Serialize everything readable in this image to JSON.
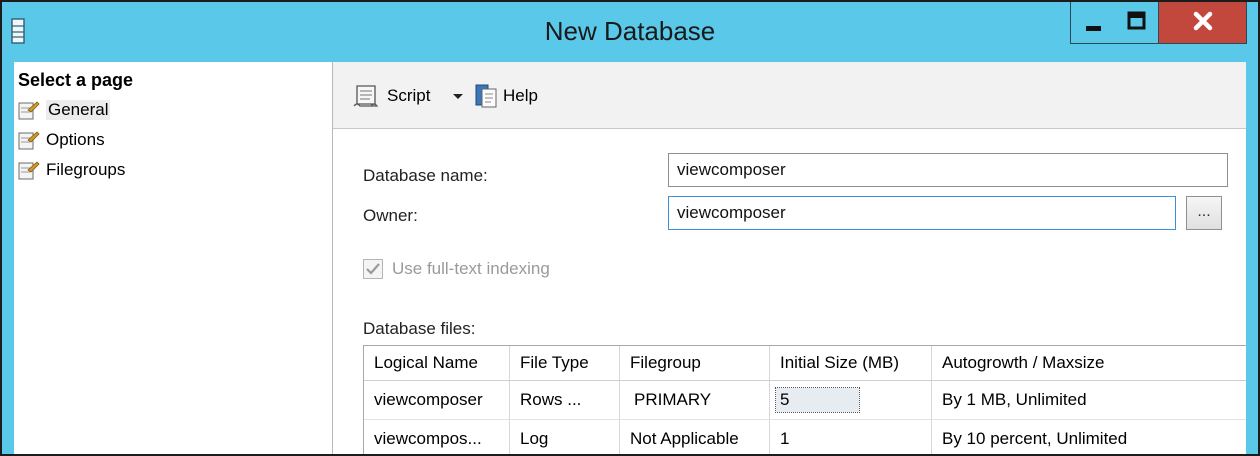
{
  "window": {
    "title": "New Database",
    "icon": "database-icon",
    "controls": {
      "minimize": "minimize-icon",
      "maximize": "maximize-icon",
      "close": "close-icon"
    },
    "colors": {
      "titlebar": "#5ac8e8",
      "close": "#c2473d"
    }
  },
  "sidebar": {
    "header": "Select a page",
    "items": [
      {
        "label": "General",
        "icon": "page-wrench-icon",
        "selected": true
      },
      {
        "label": "Options",
        "icon": "page-wrench-icon",
        "selected": false
      },
      {
        "label": "Filegroups",
        "icon": "page-wrench-icon",
        "selected": false
      }
    ]
  },
  "toolbar": {
    "script_label": "Script",
    "script_icon": "script-scroll-icon",
    "dropdown_icon": "dropdown-arrow-icon",
    "help_label": "Help",
    "help_icon": "help-book-icon"
  },
  "form": {
    "database_name_label": "Database name:",
    "database_name_value": "viewcomposer",
    "owner_label": "Owner:",
    "owner_value": "viewcomposer",
    "browse_label": "...",
    "fulltext_label": "Use full-text indexing",
    "fulltext_checked": true,
    "fulltext_enabled": false
  },
  "files": {
    "label": "Database files:",
    "columns": [
      "Logical Name",
      "File Type",
      "Filegroup",
      "Initial Size (MB)",
      "Autogrowth / Maxsize"
    ],
    "rows": [
      [
        "viewcomposer",
        "Rows ...",
        "PRIMARY",
        "5",
        "By 1 MB, Unlimited"
      ],
      [
        "viewcompos...",
        "Log",
        "Not Applicable",
        "1",
        "By 10 percent, Unlimited"
      ]
    ]
  }
}
